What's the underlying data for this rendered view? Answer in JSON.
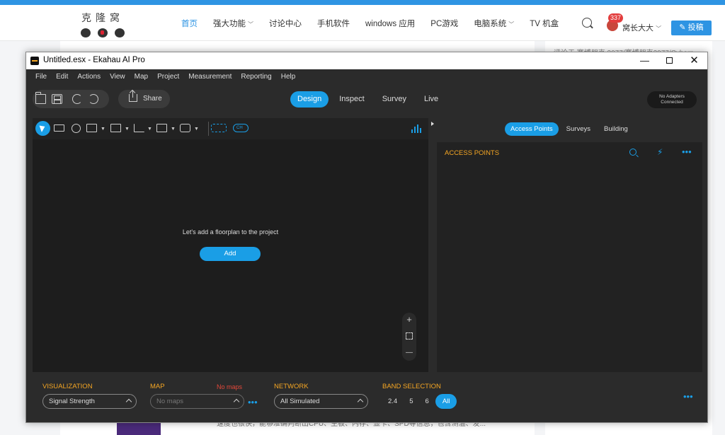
{
  "site": {
    "logo_text": "克隆窝",
    "nav": [
      {
        "label": "首页",
        "active": true,
        "caret": false
      },
      {
        "label": "强大功能",
        "active": false,
        "caret": true
      },
      {
        "label": "讨论中心",
        "active": false,
        "caret": false
      },
      {
        "label": "手机软件",
        "active": false,
        "caret": false
      },
      {
        "label": "windows 应用",
        "active": false,
        "caret": false
      },
      {
        "label": "PC游戏",
        "active": false,
        "caret": false
      },
      {
        "label": "电脑系统",
        "active": false,
        "caret": true
      },
      {
        "label": "TV 机盒",
        "active": false,
        "caret": false
      }
    ],
    "notification_count": "337",
    "username": "窝长大大",
    "post_button": "✎ 投稿",
    "sidebar_snippet": "评论于 赛博朋克 2077/赛博朋克2077/Cyberp",
    "bottom_snippet": "速度也很快，能够准确判断出CPU、主板、内存、显卡、SPD等信息，包含测温、发..."
  },
  "window": {
    "title": "Untitled.esx - Ekahau AI Pro",
    "minimize": "—",
    "close": "✕"
  },
  "menu": [
    "File",
    "Edit",
    "Actions",
    "View",
    "Map",
    "Project",
    "Measurement",
    "Reporting",
    "Help"
  ],
  "toolbar": {
    "share_label": "Share",
    "modes": [
      {
        "label": "Design",
        "active": true
      },
      {
        "label": "Inspect",
        "active": false
      },
      {
        "label": "Survey",
        "active": false
      },
      {
        "label": "Live",
        "active": false
      }
    ],
    "adapter_status_line1": "No Adapters",
    "adapter_status_line2": "Connected"
  },
  "tools": {
    "ch_label": "CH"
  },
  "canvas": {
    "empty_message": "Let's add a floorplan to the project",
    "add_button": "Add",
    "zoom_in": "+",
    "zoom_out": "—"
  },
  "right_panel": {
    "tabs": [
      {
        "label": "Access Points",
        "active": true
      },
      {
        "label": "Surveys",
        "active": false
      },
      {
        "label": "Building",
        "active": false
      }
    ],
    "section_title": "ACCESS POINTS",
    "more": "•••"
  },
  "bottom": {
    "visualization_label": "VISUALIZATION",
    "visualization_value": "Signal Strength",
    "map_label": "MAP",
    "map_warning": "No maps",
    "map_value": "No maps",
    "network_label": "NETWORK",
    "network_value": "All Simulated",
    "band_label": "BAND SELECTION",
    "bands": [
      {
        "label": "2.4",
        "active": false
      },
      {
        "label": "5",
        "active": false
      },
      {
        "label": "6",
        "active": false
      },
      {
        "label": "All",
        "active": true
      }
    ],
    "more": "•••"
  },
  "colors": {
    "accent": "#1a9ee6",
    "label_orange": "#f5a623",
    "warning_red": "#e4483a",
    "site_blue": "#2e94e3"
  }
}
